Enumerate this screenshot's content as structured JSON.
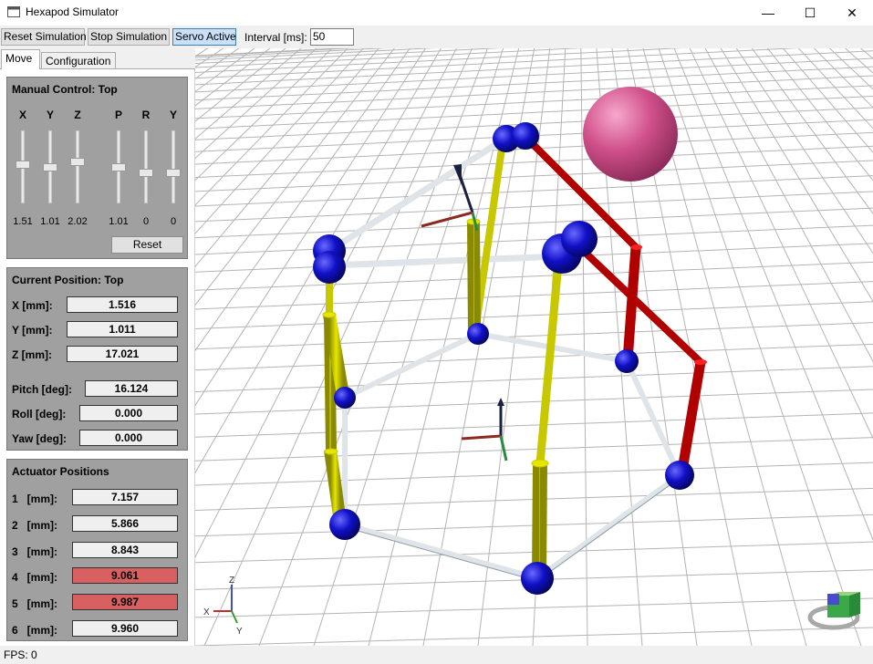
{
  "window": {
    "title": "Hexapod Simulator",
    "minimize": "—",
    "maximize": "☐",
    "close": "✕",
    "icon": "app-window-icon"
  },
  "toolbar": {
    "reset_label": "Reset Simulation",
    "stop_label": "Stop Simulation",
    "servo_label": "Servo Active",
    "interval_label": "Interval [ms]:",
    "interval_value": "50"
  },
  "tabs": [
    {
      "label": "Move"
    },
    {
      "label": "Configuration"
    }
  ],
  "manual_control": {
    "title": "Manual Control: Top",
    "sliders": [
      {
        "label": "X",
        "value": "1.51",
        "level": 0.56
      },
      {
        "label": "Y",
        "value": "1.01",
        "level": 0.52
      },
      {
        "label": "Z",
        "value": "2.02",
        "level": 0.6
      },
      {
        "label": "P",
        "value": "1.01",
        "level": 0.52
      },
      {
        "label": "R",
        "value": "0",
        "level": 0.45
      },
      {
        "label": "Y",
        "value": "0",
        "level": 0.45
      }
    ],
    "reset_label": "Reset"
  },
  "current_position": {
    "title": "Current Position: Top",
    "fields": [
      {
        "label": "X [mm]:",
        "value": "1.516"
      },
      {
        "label": "Y [mm]:",
        "value": "1.011"
      },
      {
        "label": "Z [mm]:",
        "value": "17.021"
      },
      {
        "label": "Pitch [deg]:",
        "value": "16.124"
      },
      {
        "label": "Roll [deg]:",
        "value": "0.000"
      },
      {
        "label": "Yaw [deg]:",
        "value": "0.000"
      }
    ]
  },
  "actuators": {
    "title": "Actuator Positions",
    "items": [
      {
        "label": "1   [mm]:",
        "value": "7.157",
        "alert": false
      },
      {
        "label": "2   [mm]:",
        "value": "5.866",
        "alert": false
      },
      {
        "label": "3   [mm]:",
        "value": "8.843",
        "alert": false
      },
      {
        "label": "4   [mm]:",
        "value": "9.061",
        "alert": true
      },
      {
        "label": "5   [mm]:",
        "value": "9.987",
        "alert": true
      },
      {
        "label": "6   [mm]:",
        "value": "9.960",
        "alert": true
      }
    ]
  },
  "viewport": {
    "axis_x": "X",
    "axis_y": "Y",
    "axis_z": "Z",
    "colors": {
      "joint": "#1010c8",
      "actuator": "#c8c800",
      "actuator_limit": "#b00000",
      "sphere": "#d0508a",
      "rod": "#dfe4e8"
    }
  },
  "status": {
    "fps": "FPS: 0"
  }
}
